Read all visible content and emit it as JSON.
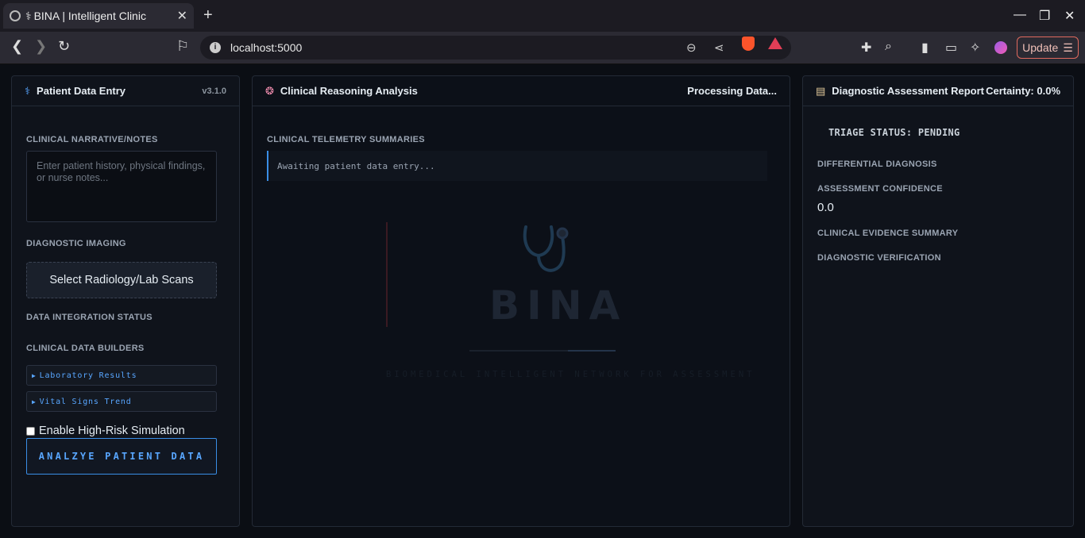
{
  "browser": {
    "tab_title": "BINA | Intelligent Clinic",
    "tab_glyph": "⚕",
    "url": "localhost:5000",
    "update_label": "Update"
  },
  "left_panel": {
    "title": "Patient Data Entry",
    "version": "v3.1.0",
    "narrative_label": "CLINICAL NARRATIVE/NOTES",
    "narrative_placeholder": "Enter patient history, physical findings, or nurse notes...",
    "imaging_label": "DIAGNOSTIC IMAGING",
    "scan_button": "Select Radiology/Lab Scans",
    "integration_label": "DATA INTEGRATION STATUS",
    "builders_label": "CLINICAL DATA BUILDERS",
    "builders": [
      {
        "label": "Laboratory Results"
      },
      {
        "label": "Vital Signs Trend"
      }
    ],
    "simulation_label": "Enable High-Risk Simulation",
    "simulation_checked": false,
    "analyze_button": "ANALZYE PATIENT DATA"
  },
  "mid_panel": {
    "title": "Clinical Reasoning Analysis",
    "status": "Processing Data...",
    "telemetry_label": "CLINICAL TELEMETRY SUMMARIES",
    "telemetry_text": "Awaiting patient data entry...",
    "logo_text": "BINA",
    "tagline": "BIOMEDICAL INTELLIGENT NETWORK FOR ASSESSMENT"
  },
  "right_panel": {
    "title": "Diagnostic Assessment Report",
    "certainty": "Certainty: 0.0%",
    "triage_status": "TRIAGE STATUS: PENDING",
    "differential_label": "DIFFERENTIAL DIAGNOSIS",
    "confidence_label": "ASSESSMENT CONFIDENCE",
    "confidence_value": "0.0",
    "evidence_label": "CLINICAL EVIDENCE SUMMARY",
    "verification_label": "DIAGNOSTIC VERIFICATION"
  },
  "colors": {
    "accent": "#58a6ff",
    "panel_bg": "#0f131b",
    "page_bg": "#0b0e14"
  }
}
